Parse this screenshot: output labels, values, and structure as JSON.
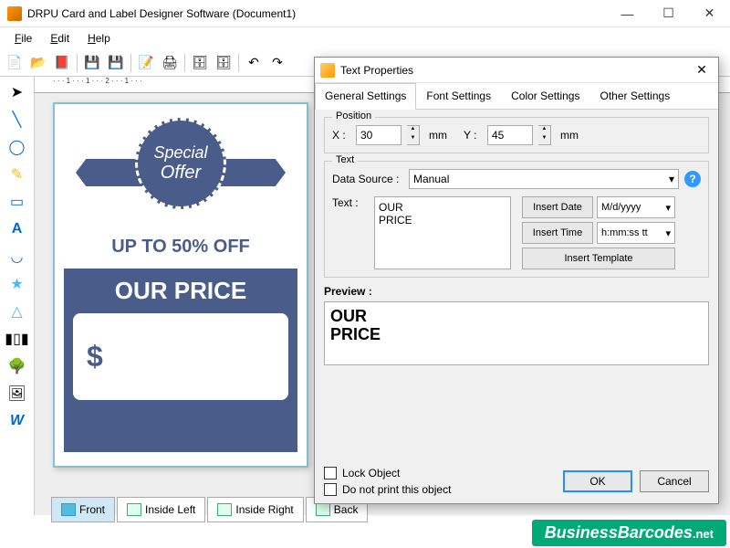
{
  "window": {
    "title": "DRPU Card and Label Designer Software (Document1)"
  },
  "menu": {
    "file": "File",
    "edit": "Edit",
    "help": "Help"
  },
  "ruler_text": "· · · 1 · · · 1 · · · 2 · · · 1 · · ·",
  "card": {
    "badge_line1": "Special",
    "badge_line2": "Offer",
    "offer": "UP TO 50% OFF",
    "price_title": "OUR\nPRICE",
    "currency": "$"
  },
  "page_tabs": [
    "Front",
    "Inside Left",
    "Inside Right",
    "Back"
  ],
  "dialog": {
    "title": "Text Properties",
    "tabs": [
      "General Settings",
      "Font Settings",
      "Color Settings",
      "Other Settings"
    ],
    "position_legend": "Position",
    "x_label": "X :",
    "x_value": "30",
    "y_label": "Y :",
    "y_value": "45",
    "unit": "mm",
    "text_legend": "Text",
    "datasource_label": "Data Source :",
    "datasource_value": "Manual",
    "text_label": "Text :",
    "text_value": "OUR\nPRICE",
    "insert_date": "Insert Date",
    "date_format": "M/d/yyyy",
    "insert_time": "Insert Time",
    "time_format": "h:mm:ss tt",
    "insert_template": "Insert Template",
    "preview_label": "Preview :",
    "preview_value": "OUR\nPRICE",
    "lock": "Lock Object",
    "noprint": "Do not print this object",
    "ok": "OK",
    "cancel": "Cancel"
  },
  "watermark": {
    "main": "BusinessBarcodes",
    "suffix": ".net"
  }
}
